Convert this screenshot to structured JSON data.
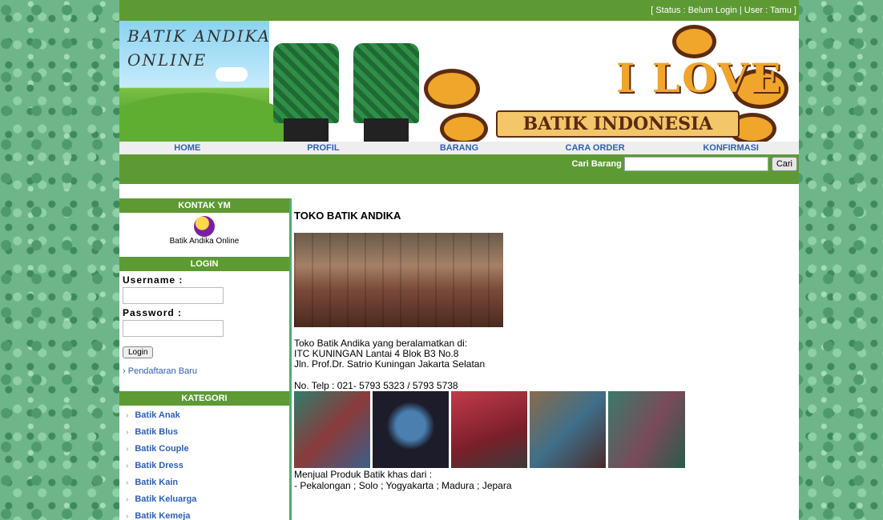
{
  "status_bar": {
    "text": "[ Status : Belum Login | User : Tamu ]"
  },
  "banner": {
    "logo_text": "BATIK ANDIKA ONLINE",
    "love_text": "I LOVE",
    "ribbon_text": "BATIK INDONESIA"
  },
  "nav": {
    "items": [
      "HOME",
      "PROFIL",
      "BARANG",
      "CARA ORDER",
      "KONFIRMASI"
    ]
  },
  "search": {
    "label": "Cari Barang",
    "value": "",
    "button": "Cari"
  },
  "sidebar": {
    "contact_title": "KONTAK YM",
    "ym_label": "Batik Andika Online",
    "login_title": "LOGIN",
    "username_label": "Username :",
    "password_label": "Password :",
    "login_button": "Login",
    "register_link": "Pendaftaran Baru",
    "category_title": "KATEGORI",
    "categories": [
      "Batik Anak",
      "Batik Blus",
      "Batik Couple",
      "Batik Dress",
      "Batik Kain",
      "Batik Keluarga",
      "Batik Kemeja"
    ]
  },
  "content": {
    "title": "TOKO BATIK ANDIKA",
    "address_lines": [
      "Toko Batik Andika yang beralamatkan di:",
      "ITC KUNINGAN Lantai 4 Blok B3 No.8",
      "Jln. Prof.Dr. Satrio Kuningan Jakarta Selatan"
    ],
    "phone": "No. Telp : 021- 5793 5323 / 5793 5738",
    "sell_lines": [
      "Menjual Produk Batik khas dari :",
      "- Pekalongan ; Solo ; Yogyakarta ; Madura ; Jepara"
    ]
  },
  "colors": {
    "brand_green": "#5e9a34",
    "link_blue": "#2f5fb7",
    "accent_teal": "#4caf70"
  }
}
